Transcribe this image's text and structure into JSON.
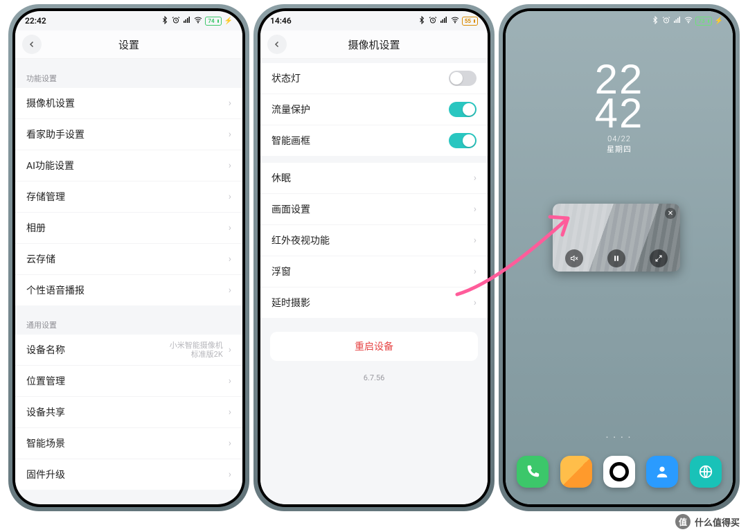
{
  "status": {
    "p1_time": "22:42",
    "p1_batt": "74",
    "p2_time": "14:46",
    "p2_batt": "55",
    "p3_batt": "73"
  },
  "p1": {
    "title": "设置",
    "section_a": "功能设置",
    "items_a": [
      "摄像机设置",
      "看家助手设置",
      "AI功能设置",
      "存储管理",
      "相册",
      "云存储",
      "个性语音播报"
    ],
    "section_b": "通用设置",
    "device_name_label": "设备名称",
    "device_name_value_l1": "小米智能摄像机",
    "device_name_value_l2": "标准版2K",
    "items_b": [
      "位置管理",
      "设备共享",
      "智能场景",
      "固件升级"
    ]
  },
  "p2": {
    "title": "摄像机设置",
    "toggles": [
      {
        "label": "状态灯",
        "on": false
      },
      {
        "label": "流量保护",
        "on": true
      },
      {
        "label": "智能画框",
        "on": true
      }
    ],
    "links": [
      "休眠",
      "画面设置",
      "红外夜视功能",
      "浮窗",
      "延时摄影"
    ],
    "danger": "重启设备",
    "version": "6.7.56"
  },
  "p3": {
    "clock_hh": "22",
    "clock_mm": "42",
    "date": "04/22",
    "dow": "星期四"
  },
  "watermark": {
    "badge": "值",
    "text": "什么值得买"
  }
}
